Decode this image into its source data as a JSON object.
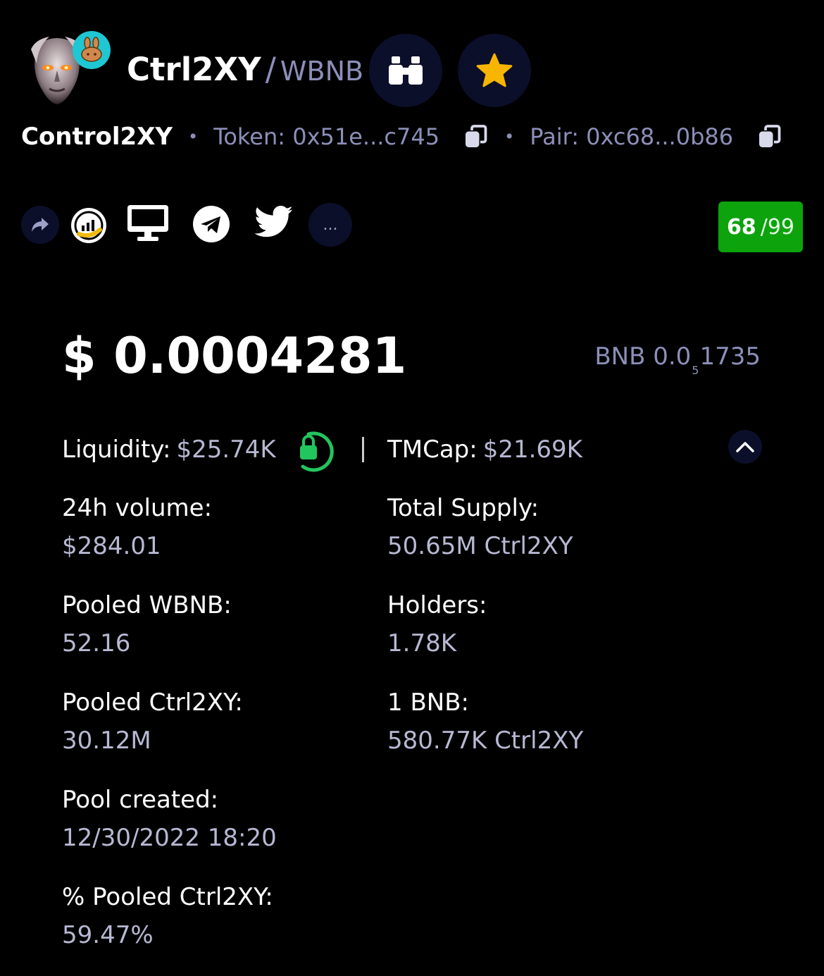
{
  "header": {
    "symbol": "Ctrl2XY",
    "quote": "WBNB",
    "token_name": "Control2XY",
    "token_address": "Token: 0x51e...c745",
    "pair_address": "Pair: 0xc68...0b86"
  },
  "score": {
    "value": "68",
    "max": "/99"
  },
  "price": {
    "usd": "$ 0.0004281",
    "bnb_prefix": "BNB 0.0",
    "bnb_zeros": "5",
    "bnb_digits": "1735"
  },
  "stats": {
    "liquidity_label": "Liquidity:",
    "liquidity_value": "$25.74K",
    "tmcap_label": "TMCap:",
    "tmcap_value": "$21.69K",
    "volume_label": "24h volume:",
    "volume_value": "$284.01",
    "supply_label": "Total Supply:",
    "supply_value": "50.65M Ctrl2XY",
    "pooled_wbnb_label": "Pooled WBNB:",
    "pooled_wbnb_value": "52.16",
    "holders_label": "Holders:",
    "holders_value": "1.78K",
    "pooled_token_label": "Pooled Ctrl2XY:",
    "pooled_token_value": "30.12M",
    "rate_label": "1 BNB:",
    "rate_value": "580.77K Ctrl2XY",
    "created_label": "Pool created:",
    "created_value": "12/30/2022 18:20",
    "pct_label": "% Pooled Ctrl2XY:",
    "pct_value": "59.47%"
  },
  "social": {
    "more_label": "..."
  },
  "colors": {
    "background": "#000000",
    "muted": "#8c8fb8",
    "score_bg": "#0ca30c",
    "lock_green": "#22c55e",
    "star": "#f7b500"
  },
  "icons": [
    "pancakeswap-icon",
    "binoculars-icon",
    "star-icon",
    "copy-icon",
    "share-icon",
    "coinmarketcap-icon",
    "website-icon",
    "telegram-icon",
    "twitter-icon",
    "lock-icon",
    "chevron-up-icon"
  ]
}
